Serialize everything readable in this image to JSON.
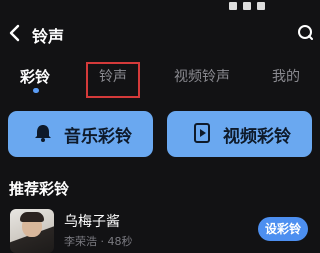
{
  "header": {
    "title": "铃声",
    "back_icon": "back-arrow-icon",
    "search_icon": "search-icon"
  },
  "tabs": [
    {
      "label": "彩铃",
      "active": true
    },
    {
      "label": "铃声",
      "active": false
    },
    {
      "label": "视频铃声",
      "active": false
    },
    {
      "label": "我的",
      "active": false
    }
  ],
  "actions": {
    "music_label": "音乐彩铃",
    "music_icon": "bell-icon",
    "video_label": "视频彩铃",
    "video_icon": "video-file-icon",
    "color": "#6aa8f0"
  },
  "recommended": {
    "title": "推荐彩铃",
    "items": [
      {
        "title": "乌梅子酱",
        "meta": "李荣浩 · 48秒",
        "button": "设彩铃"
      }
    ]
  },
  "accent_color": "#4d8ff0",
  "highlight_color": "#d43a3a"
}
